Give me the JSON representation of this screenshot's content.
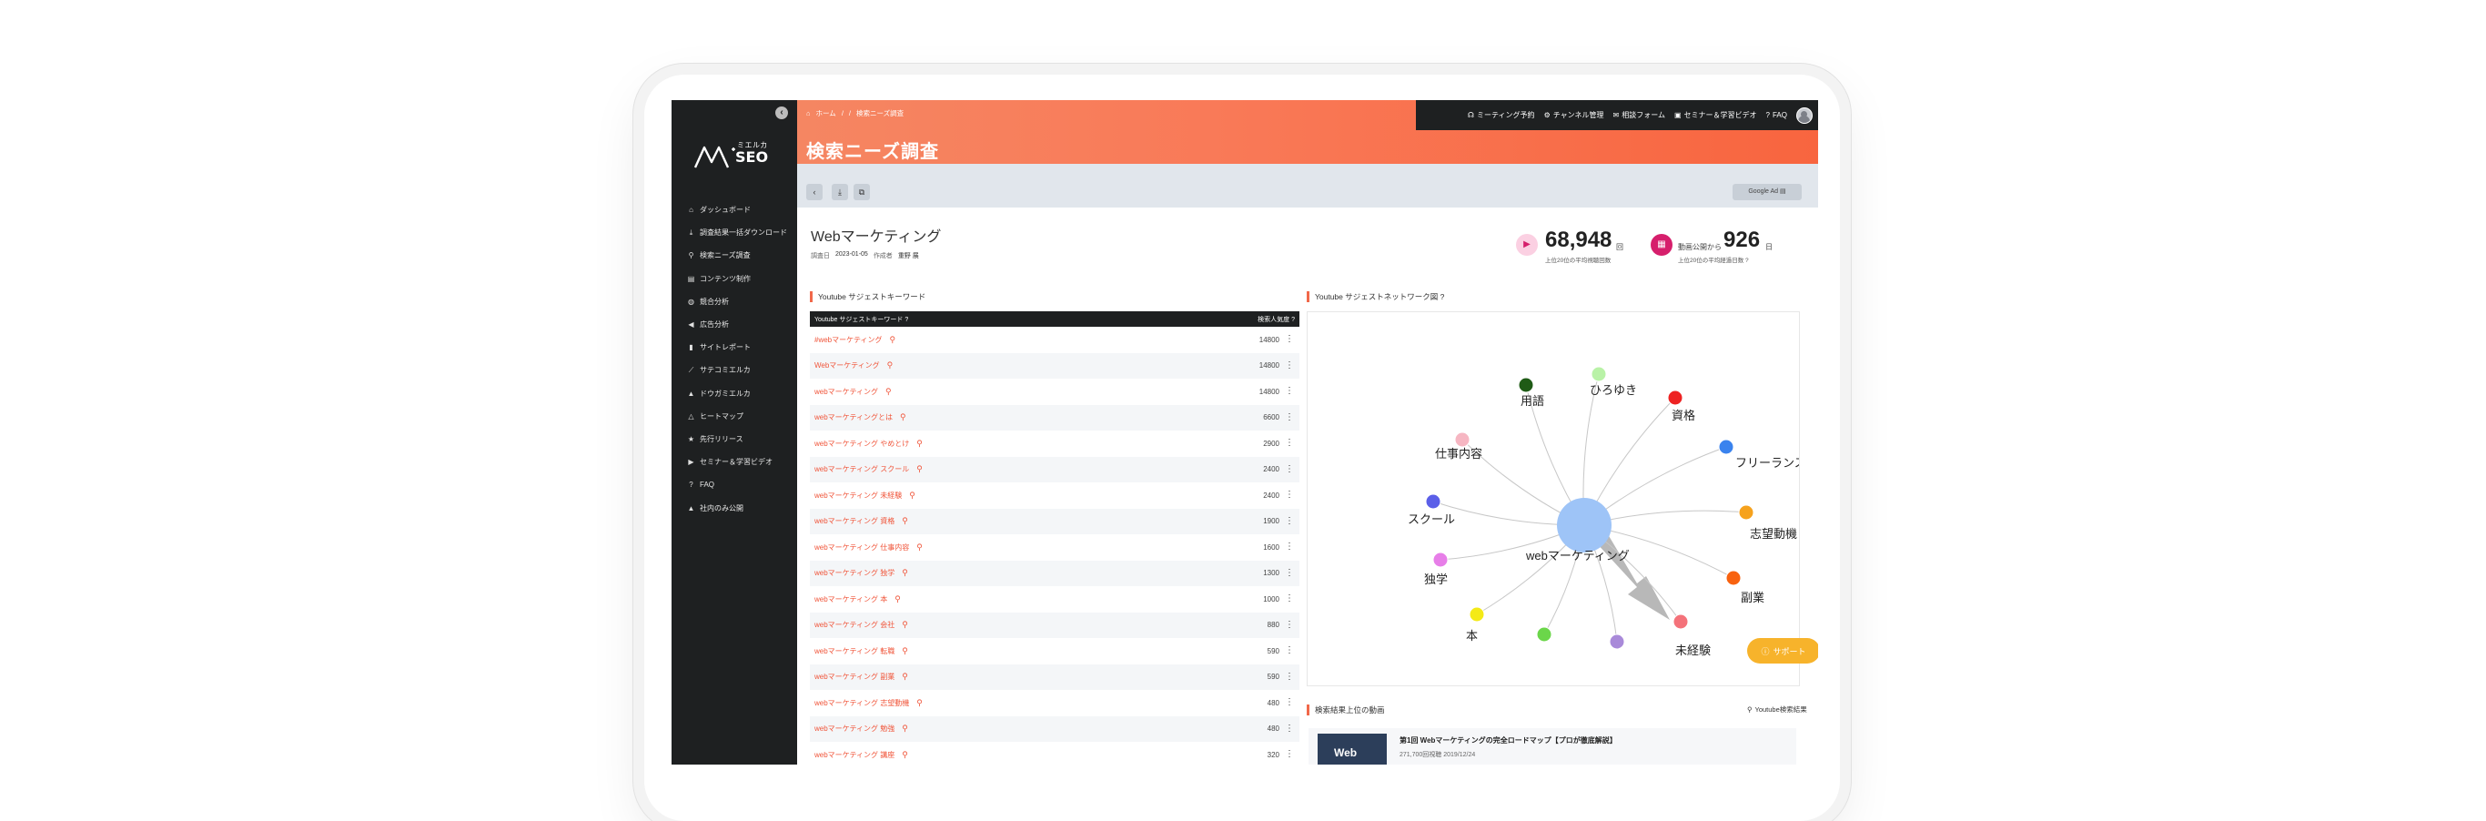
{
  "sidebar": {
    "logo_text": "ミエルカ",
    "logo_product": "SEO",
    "items": [
      {
        "label": "ダッシュボード",
        "icon": "home-icon"
      },
      {
        "label": "調査結果一括ダウンロード",
        "icon": "download-icon"
      },
      {
        "label": "検索ニーズ調査",
        "icon": "search-icon"
      },
      {
        "label": "コンテンツ制作",
        "icon": "document-icon"
      },
      {
        "label": "競合分析",
        "icon": "globe-icon"
      },
      {
        "label": "広告分析",
        "icon": "megaphone-icon"
      },
      {
        "label": "サイトレポート",
        "icon": "bar-chart-icon"
      },
      {
        "label": "サテコミエルカ",
        "icon": "satellite-icon"
      },
      {
        "label": "ドウガミエルカ",
        "icon": "mountain-icon"
      },
      {
        "label": "ヒートマップ",
        "icon": "mountain-icon"
      },
      {
        "label": "先行リリース",
        "icon": "star-icon"
      },
      {
        "label": "セミナー＆学習ビデオ",
        "icon": "video-icon"
      },
      {
        "label": "FAQ",
        "icon": "question-icon"
      },
      {
        "label": "社内のみ公開",
        "icon": "mountain-icon"
      }
    ]
  },
  "header": {
    "breadcrumb": [
      "ホーム",
      "検索ニーズ調査"
    ],
    "title": "検索ニーズ調査",
    "topbar": [
      "ミーティング予約",
      "チャンネル管理",
      "相談フォーム",
      "セミナー＆学習ビデオ",
      "FAQ"
    ]
  },
  "toolbar": {
    "google_ads_label": "Google Ad"
  },
  "keyword": {
    "title": "Webマーケティング",
    "date_label": "調査日",
    "date": "2023-01-05",
    "author_label": "作成者",
    "author": "重野 展"
  },
  "stats": {
    "views_value": "68,948",
    "views_unit": "回",
    "views_sub": "上位20位の平均視聴回数",
    "days_prefix": "動画公開から",
    "days_value": "926",
    "days_unit": "日",
    "days_sub": "上位20位の平均経過日数"
  },
  "suggest": {
    "section_title": "Youtube サジェストキーワード",
    "col_keyword": "Youtube サジェストキーワード",
    "col_volume": "検索人気度",
    "rows": [
      {
        "kw": "#webマーケティング",
        "vol": "14800"
      },
      {
        "kw": "Webマーケティング",
        "vol": "14800"
      },
      {
        "kw": "webマーケティング",
        "vol": "14800"
      },
      {
        "kw": "webマーケティングとは",
        "vol": "6600"
      },
      {
        "kw": "webマーケティング やめとけ",
        "vol": "2900"
      },
      {
        "kw": "webマーケティング スクール",
        "vol": "2400"
      },
      {
        "kw": "webマーケティング 未経験",
        "vol": "2400"
      },
      {
        "kw": "webマーケティング 資格",
        "vol": "1900"
      },
      {
        "kw": "webマーケティング 仕事内容",
        "vol": "1600"
      },
      {
        "kw": "webマーケティング 独学",
        "vol": "1300"
      },
      {
        "kw": "webマーケティング 本",
        "vol": "1000"
      },
      {
        "kw": "webマーケティング 会社",
        "vol": "880"
      },
      {
        "kw": "webマーケティング 転職",
        "vol": "590"
      },
      {
        "kw": "webマーケティング 副業",
        "vol": "590"
      },
      {
        "kw": "webマーケティング 志望動機",
        "vol": "480"
      },
      {
        "kw": "webマーケティング 勉強",
        "vol": "480"
      },
      {
        "kw": "webマーケティング 講座",
        "vol": "320"
      }
    ]
  },
  "network": {
    "section_title": "Youtube サジェストネットワーク図",
    "center_label": "webマーケティング",
    "nodes": [
      {
        "label": "用語",
        "color": "#1f5b16"
      },
      {
        "label": "ひろゆき",
        "color": "#b9f2a7"
      },
      {
        "label": "資格",
        "color": "#ee2222"
      },
      {
        "label": "仕事内容",
        "color": "#f6b6c2"
      },
      {
        "label": "フリーランス",
        "color": "#3a83ee"
      },
      {
        "label": "スクール",
        "color": "#5b5fe8"
      },
      {
        "label": "志望動機",
        "color": "#f6a21d"
      },
      {
        "label": "独学",
        "color": "#e77ee8"
      },
      {
        "label": "副業",
        "color": "#f8620f"
      },
      {
        "label": "本",
        "color": "#f4ea17"
      },
      {
        "label": "未経験",
        "color": "#f4727a"
      },
      {
        "label": "",
        "color": "#6bd64a"
      },
      {
        "label": "",
        "color": "#a98ad9"
      }
    ],
    "center_color": "#9ec4f7"
  },
  "support_label": "サポート",
  "videos": {
    "section_title": "検索結果上位の動画",
    "link_label": "Youtube検索結果",
    "items": [
      {
        "title": "第1回 Webマーケティングの完全ロードマップ【プロが徹底解説】",
        "meta": "271,700回視聴 2019/12/24",
        "thumb_text": "Web"
      }
    ]
  }
}
